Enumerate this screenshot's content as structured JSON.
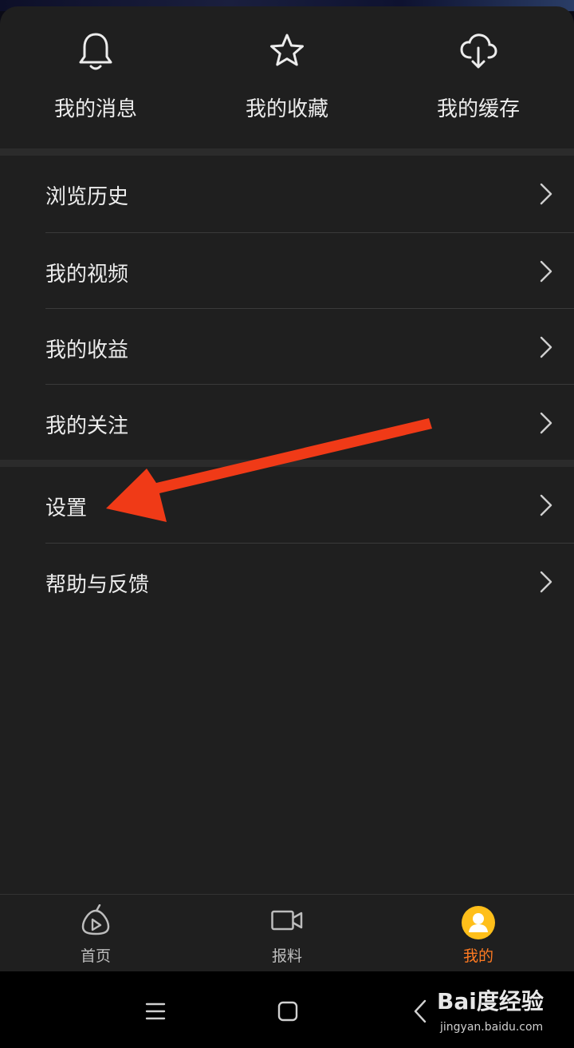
{
  "quick_actions": [
    {
      "label": "我的消息",
      "icon": "bell-icon"
    },
    {
      "label": "我的收藏",
      "icon": "star-icon"
    },
    {
      "label": "我的缓存",
      "icon": "cloud-download-icon"
    }
  ],
  "menu": {
    "group1": [
      {
        "label": "浏览历史"
      },
      {
        "label": "我的视频"
      },
      {
        "label": "我的收益"
      },
      {
        "label": "我的关注"
      }
    ],
    "group2": [
      {
        "label": "设置"
      },
      {
        "label": "帮助与反馈"
      }
    ]
  },
  "tabbar": {
    "tabs": [
      {
        "label": "首页",
        "icon": "home-play-icon"
      },
      {
        "label": "报料",
        "icon": "video-camera-icon"
      },
      {
        "label": "我的",
        "icon": "avatar",
        "active": true
      }
    ],
    "active_color": "#ff7a21"
  },
  "navbar": {
    "buttons": [
      "menu-icon",
      "home-square-icon",
      "back-icon"
    ]
  },
  "watermark": {
    "logo": "Bai度经验",
    "url": "jingyan.baidu.com"
  },
  "annotation": {
    "arrow_color": "#f03a17"
  }
}
